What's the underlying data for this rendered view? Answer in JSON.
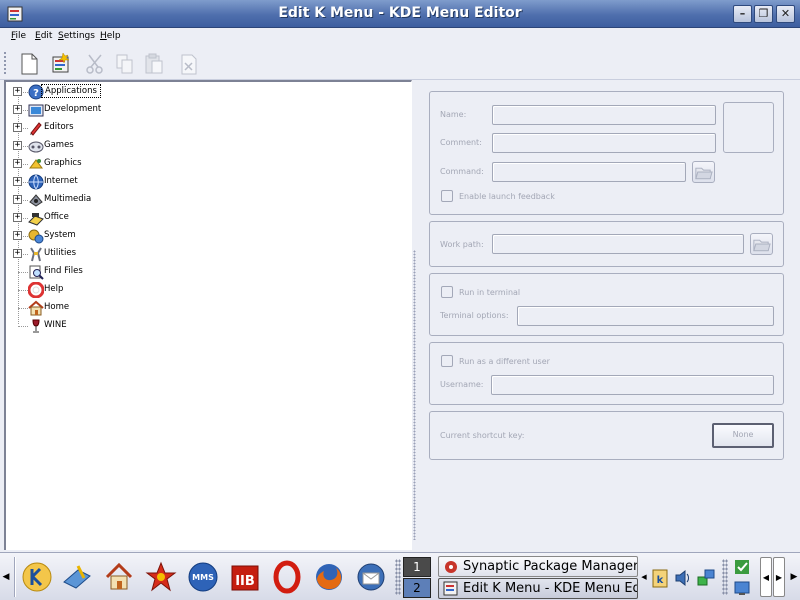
{
  "window": {
    "title": "Edit K Menu - KDE Menu Editor"
  },
  "menubar": {
    "items": [
      "File",
      "Edit",
      "Settings",
      "Help"
    ]
  },
  "tree": {
    "items": [
      {
        "label": "Applications",
        "expandable": true,
        "icon": "applications-icon"
      },
      {
        "label": "Development",
        "expandable": true,
        "icon": "development-icon"
      },
      {
        "label": "Editors",
        "expandable": true,
        "icon": "editors-icon"
      },
      {
        "label": "Games",
        "expandable": true,
        "icon": "games-icon"
      },
      {
        "label": "Graphics",
        "expandable": true,
        "icon": "graphics-icon"
      },
      {
        "label": "Internet",
        "expandable": true,
        "icon": "internet-icon"
      },
      {
        "label": "Multimedia",
        "expandable": true,
        "icon": "multimedia-icon"
      },
      {
        "label": "Office",
        "expandable": true,
        "icon": "office-icon"
      },
      {
        "label": "System",
        "expandable": true,
        "icon": "system-icon"
      },
      {
        "label": "Utilities",
        "expandable": true,
        "icon": "utilities-icon"
      },
      {
        "label": "Find Files",
        "expandable": false,
        "icon": "find-files-icon"
      },
      {
        "label": "Help",
        "expandable": false,
        "icon": "help-icon"
      },
      {
        "label": "Home",
        "expandable": false,
        "icon": "home-icon"
      },
      {
        "label": "WINE",
        "expandable": false,
        "icon": "wine-icon"
      }
    ]
  },
  "form": {
    "name_label": "Name:",
    "comment_label": "Comment:",
    "command_label": "Command:",
    "launch_feedback_label": "Enable launch feedback",
    "work_path_label": "Work path:",
    "run_in_terminal_label": "Run in terminal",
    "terminal_options_label": "Terminal options:",
    "run_as_user_label": "Run as a different user",
    "username_label": "Username:",
    "shortcut_label": "Current shortcut key:",
    "shortcut_button": "None"
  },
  "taskbar": {
    "pager": [
      "1",
      "2"
    ],
    "tasks": [
      "Synaptic Package Manager",
      "Edit K Menu - KDE Menu Editor"
    ]
  }
}
